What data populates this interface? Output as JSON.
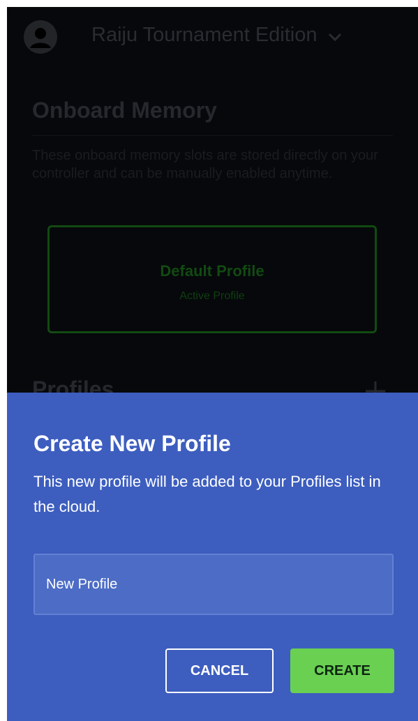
{
  "background": {
    "device_name": "Raiju Tournament Edition",
    "onboard_memory": {
      "title": "Onboard Memory",
      "description": "These onboard memory slots are stored directly on your controller and can be manually enabled anytime.",
      "profile_card": {
        "name": "Default Profile",
        "status": "Active Profile"
      }
    },
    "profiles": {
      "title": "Profiles"
    }
  },
  "dialog": {
    "title": "Create New Profile",
    "description": "This new profile will be added to your Profiles list in the cloud.",
    "name_input": {
      "value": "New Profile"
    },
    "cancel_label": "CANCEL",
    "create_label": "CREATE"
  },
  "colors": {
    "sheet_background": "#3d5ebf",
    "create_button": "#6ad052",
    "active_profile_accent": "#44ff22"
  },
  "icons": {
    "avatar": "user-avatar-icon",
    "device_dropdown": "chevron-down-icon",
    "add_profile": "plus-icon"
  }
}
